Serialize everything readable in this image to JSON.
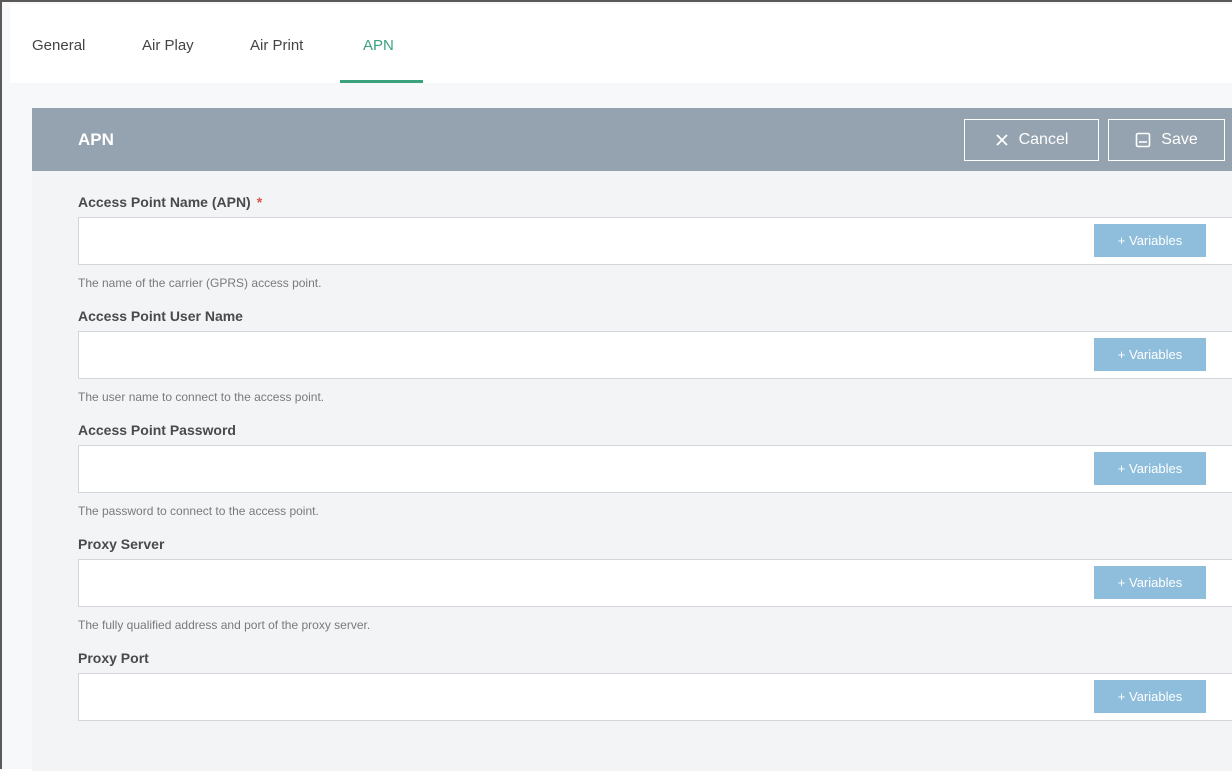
{
  "tabs": [
    {
      "label": "General",
      "active": false
    },
    {
      "label": "Air Play",
      "active": false
    },
    {
      "label": "Air Print",
      "active": false
    },
    {
      "label": "APN",
      "active": true
    }
  ],
  "panel": {
    "title": "APN",
    "cancel_label": "Cancel",
    "save_label": "Save",
    "cancel_icon": "close-icon",
    "save_icon": "floppy-disk-icon"
  },
  "fields": [
    {
      "label": "Access Point Name (APN)",
      "required": "*",
      "value": "",
      "variables_label": "+ Variables",
      "help": "The name of the carrier (GPRS) access point."
    },
    {
      "label": "Access Point User Name",
      "value": "",
      "variables_label": "+ Variables",
      "help": "The user name to connect to the access point."
    },
    {
      "label": "Access Point Password",
      "value": "",
      "variables_label": "+ Variables",
      "help": "The password to connect to the access point."
    },
    {
      "label": "Proxy Server",
      "value": "",
      "variables_label": "+ Variables",
      "help": "The fully qualified address and port of the proxy server."
    },
    {
      "label": "Proxy Port",
      "value": "",
      "variables_label": "+ Variables"
    }
  ],
  "colors": {
    "accent": "#3aa27d",
    "header_bg": "#95a3b0",
    "variables_bg": "#8fbedc",
    "required": "#d9534f"
  }
}
